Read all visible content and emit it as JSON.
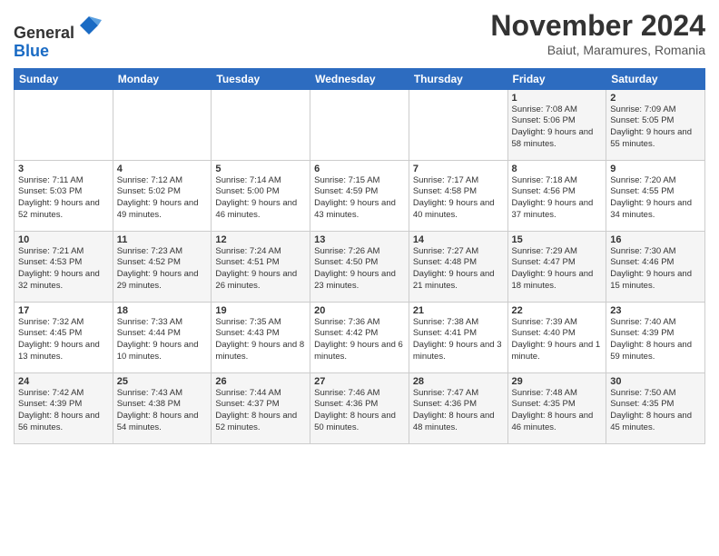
{
  "logo": {
    "line1": "General",
    "line2": "Blue"
  },
  "title": "November 2024",
  "location": "Baiut, Maramures, Romania",
  "days_of_week": [
    "Sunday",
    "Monday",
    "Tuesday",
    "Wednesday",
    "Thursday",
    "Friday",
    "Saturday"
  ],
  "weeks": [
    [
      {
        "day": "",
        "content": ""
      },
      {
        "day": "",
        "content": ""
      },
      {
        "day": "",
        "content": ""
      },
      {
        "day": "",
        "content": ""
      },
      {
        "day": "",
        "content": ""
      },
      {
        "day": "1",
        "content": "Sunrise: 7:08 AM\nSunset: 5:06 PM\nDaylight: 9 hours and 58 minutes."
      },
      {
        "day": "2",
        "content": "Sunrise: 7:09 AM\nSunset: 5:05 PM\nDaylight: 9 hours and 55 minutes."
      }
    ],
    [
      {
        "day": "3",
        "content": "Sunrise: 7:11 AM\nSunset: 5:03 PM\nDaylight: 9 hours and 52 minutes."
      },
      {
        "day": "4",
        "content": "Sunrise: 7:12 AM\nSunset: 5:02 PM\nDaylight: 9 hours and 49 minutes."
      },
      {
        "day": "5",
        "content": "Sunrise: 7:14 AM\nSunset: 5:00 PM\nDaylight: 9 hours and 46 minutes."
      },
      {
        "day": "6",
        "content": "Sunrise: 7:15 AM\nSunset: 4:59 PM\nDaylight: 9 hours and 43 minutes."
      },
      {
        "day": "7",
        "content": "Sunrise: 7:17 AM\nSunset: 4:58 PM\nDaylight: 9 hours and 40 minutes."
      },
      {
        "day": "8",
        "content": "Sunrise: 7:18 AM\nSunset: 4:56 PM\nDaylight: 9 hours and 37 minutes."
      },
      {
        "day": "9",
        "content": "Sunrise: 7:20 AM\nSunset: 4:55 PM\nDaylight: 9 hours and 34 minutes."
      }
    ],
    [
      {
        "day": "10",
        "content": "Sunrise: 7:21 AM\nSunset: 4:53 PM\nDaylight: 9 hours and 32 minutes."
      },
      {
        "day": "11",
        "content": "Sunrise: 7:23 AM\nSunset: 4:52 PM\nDaylight: 9 hours and 29 minutes."
      },
      {
        "day": "12",
        "content": "Sunrise: 7:24 AM\nSunset: 4:51 PM\nDaylight: 9 hours and 26 minutes."
      },
      {
        "day": "13",
        "content": "Sunrise: 7:26 AM\nSunset: 4:50 PM\nDaylight: 9 hours and 23 minutes."
      },
      {
        "day": "14",
        "content": "Sunrise: 7:27 AM\nSunset: 4:48 PM\nDaylight: 9 hours and 21 minutes."
      },
      {
        "day": "15",
        "content": "Sunrise: 7:29 AM\nSunset: 4:47 PM\nDaylight: 9 hours and 18 minutes."
      },
      {
        "day": "16",
        "content": "Sunrise: 7:30 AM\nSunset: 4:46 PM\nDaylight: 9 hours and 15 minutes."
      }
    ],
    [
      {
        "day": "17",
        "content": "Sunrise: 7:32 AM\nSunset: 4:45 PM\nDaylight: 9 hours and 13 minutes."
      },
      {
        "day": "18",
        "content": "Sunrise: 7:33 AM\nSunset: 4:44 PM\nDaylight: 9 hours and 10 minutes."
      },
      {
        "day": "19",
        "content": "Sunrise: 7:35 AM\nSunset: 4:43 PM\nDaylight: 9 hours and 8 minutes."
      },
      {
        "day": "20",
        "content": "Sunrise: 7:36 AM\nSunset: 4:42 PM\nDaylight: 9 hours and 6 minutes."
      },
      {
        "day": "21",
        "content": "Sunrise: 7:38 AM\nSunset: 4:41 PM\nDaylight: 9 hours and 3 minutes."
      },
      {
        "day": "22",
        "content": "Sunrise: 7:39 AM\nSunset: 4:40 PM\nDaylight: 9 hours and 1 minute."
      },
      {
        "day": "23",
        "content": "Sunrise: 7:40 AM\nSunset: 4:39 PM\nDaylight: 8 hours and 59 minutes."
      }
    ],
    [
      {
        "day": "24",
        "content": "Sunrise: 7:42 AM\nSunset: 4:39 PM\nDaylight: 8 hours and 56 minutes."
      },
      {
        "day": "25",
        "content": "Sunrise: 7:43 AM\nSunset: 4:38 PM\nDaylight: 8 hours and 54 minutes."
      },
      {
        "day": "26",
        "content": "Sunrise: 7:44 AM\nSunset: 4:37 PM\nDaylight: 8 hours and 52 minutes."
      },
      {
        "day": "27",
        "content": "Sunrise: 7:46 AM\nSunset: 4:36 PM\nDaylight: 8 hours and 50 minutes."
      },
      {
        "day": "28",
        "content": "Sunrise: 7:47 AM\nSunset: 4:36 PM\nDaylight: 8 hours and 48 minutes."
      },
      {
        "day": "29",
        "content": "Sunrise: 7:48 AM\nSunset: 4:35 PM\nDaylight: 8 hours and 46 minutes."
      },
      {
        "day": "30",
        "content": "Sunrise: 7:50 AM\nSunset: 4:35 PM\nDaylight: 8 hours and 45 minutes."
      }
    ]
  ]
}
